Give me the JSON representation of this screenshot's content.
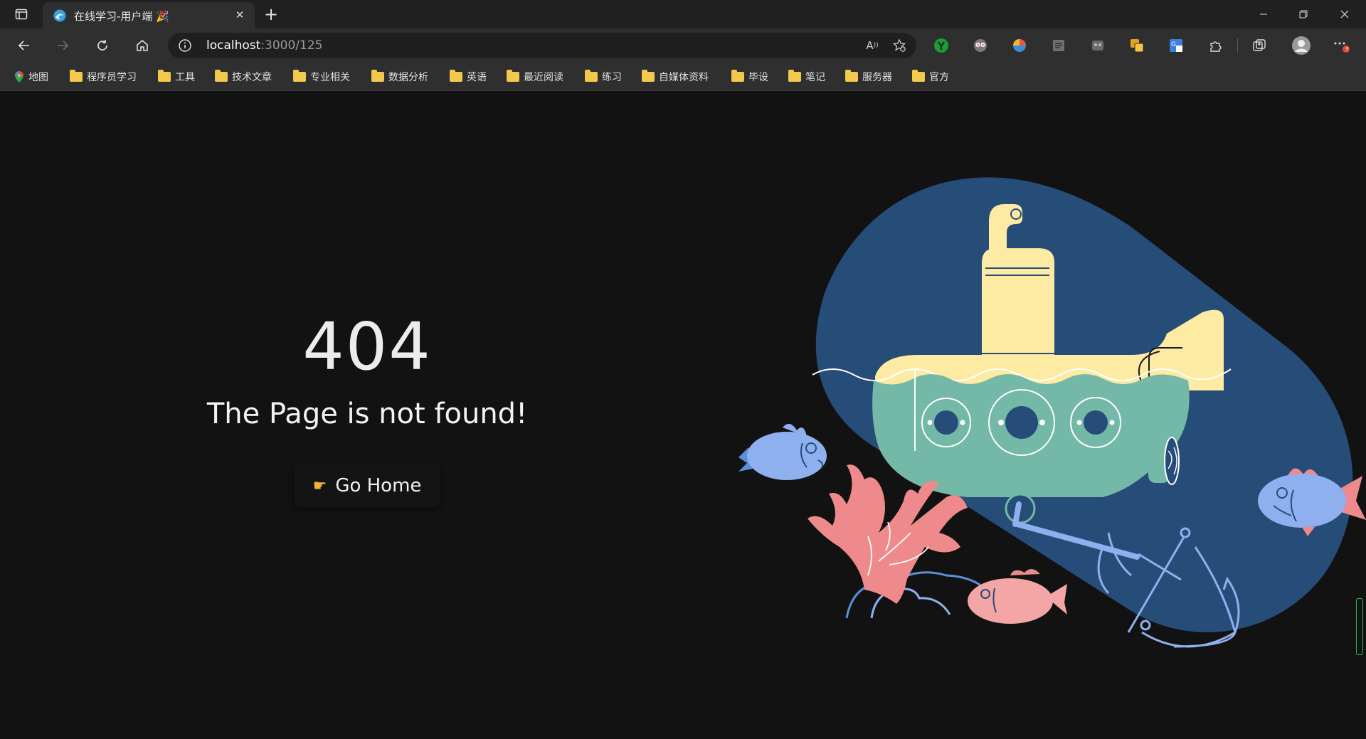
{
  "tab": {
    "title": "在线学习-用户端 🎉"
  },
  "address": {
    "host": "localhost",
    "path": ":3000/125"
  },
  "bookmarks": [
    {
      "label": "地图",
      "icon": "maps-pin-icon"
    },
    {
      "label": "程序员学习",
      "icon": "folder-icon"
    },
    {
      "label": "工具",
      "icon": "folder-icon"
    },
    {
      "label": "技术文章",
      "icon": "folder-icon"
    },
    {
      "label": "专业相关",
      "icon": "folder-icon"
    },
    {
      "label": "数据分析",
      "icon": "folder-icon"
    },
    {
      "label": "英语",
      "icon": "folder-icon"
    },
    {
      "label": "最近阅读",
      "icon": "folder-icon"
    },
    {
      "label": "练习",
      "icon": "folder-icon"
    },
    {
      "label": "自媒体资料",
      "icon": "folder-icon"
    },
    {
      "label": "毕设",
      "icon": "folder-icon"
    },
    {
      "label": "笔记",
      "icon": "folder-icon"
    },
    {
      "label": "服务器",
      "icon": "folder-icon"
    },
    {
      "label": "官方",
      "icon": "folder-icon"
    }
  ],
  "page": {
    "code": "404",
    "message": "The Page is not found!",
    "home_label": "Go Home",
    "home_icon": "pointing-hand-icon"
  },
  "colors": {
    "background": "#121212",
    "blob": "#264c78",
    "submarine_top": "#fdeaa3",
    "submarine_hull": "#74b8a8",
    "coral": "#ee8a8c",
    "fish_blue": "#8fb0ef",
    "fish_pink": "#f4a6a6"
  }
}
